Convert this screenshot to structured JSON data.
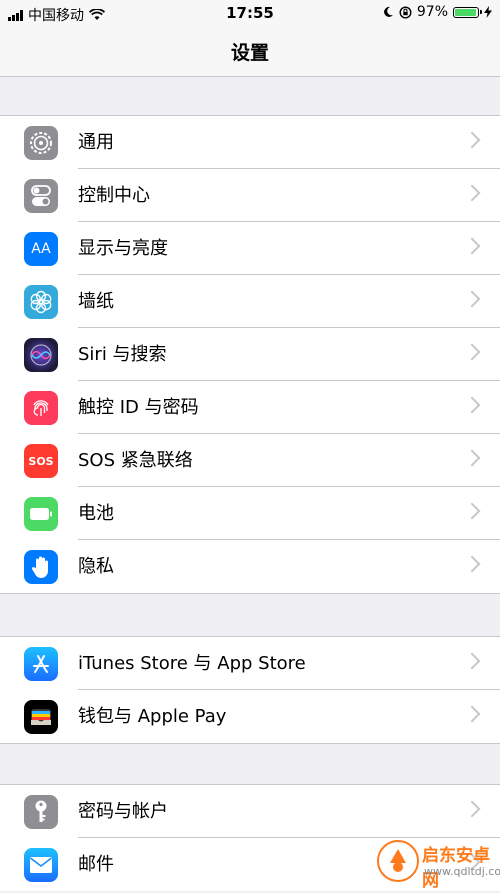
{
  "status_bar": {
    "carrier": "中国移动",
    "time": "17:55",
    "battery": "97%",
    "battery_level": 0.97
  },
  "nav": {
    "title": "设置"
  },
  "groups": [
    {
      "items": [
        {
          "label": "通用",
          "icon": "gear-icon",
          "color": "#8e8e93"
        },
        {
          "label": "控制中心",
          "icon": "toggles-icon",
          "color": "#8e8e93"
        },
        {
          "label": "显示与亮度",
          "icon": "aa-icon",
          "icon_text": "AA",
          "color": "#007aff"
        },
        {
          "label": "墙纸",
          "icon": "flower-icon",
          "color": "#34aadc"
        },
        {
          "label": "Siri 与搜索",
          "icon": "siri-icon",
          "color": "#1c1c3a"
        },
        {
          "label": "触控 ID 与密码",
          "icon": "fingerprint-icon",
          "color": "#ff3b5c"
        },
        {
          "label": "SOS 紧急联络",
          "icon": "sos-icon",
          "icon_text": "SOS",
          "color": "#ff3b30"
        },
        {
          "label": "电池",
          "icon": "battery-icon",
          "color": "#4cd964"
        },
        {
          "label": "隐私",
          "icon": "hand-icon",
          "color": "#007aff"
        }
      ]
    },
    {
      "items": [
        {
          "label": "iTunes Store 与 App Store",
          "icon": "app-store-icon",
          "color": "#1a8cff"
        },
        {
          "label": "钱包与 Apple Pay",
          "icon": "wallet-icon",
          "color": "#000000"
        }
      ]
    },
    {
      "items": [
        {
          "label": "密码与帐户",
          "icon": "key-icon",
          "color": "#8e8e93"
        },
        {
          "label": "邮件",
          "icon": "mail-icon",
          "color": "#1a8cff"
        }
      ]
    }
  ],
  "watermark": {
    "name": "启东安卓网",
    "url": "www.qdltdj.com"
  }
}
